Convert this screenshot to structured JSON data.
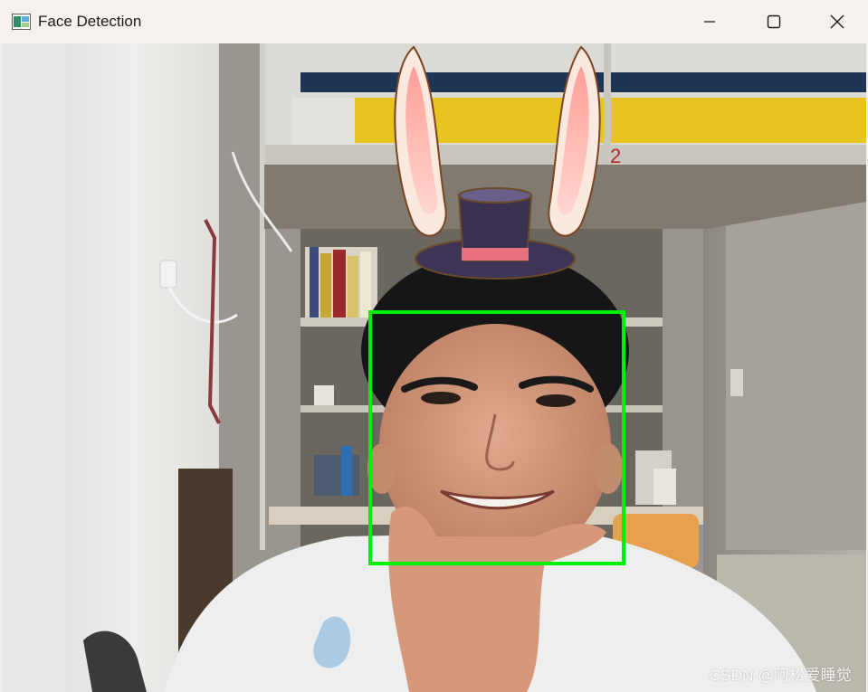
{
  "window": {
    "title": "Face Detection",
    "controls": {
      "minimize_icon": "minimize-icon",
      "maximize_icon": "maximize-icon",
      "close_icon": "close-icon"
    }
  },
  "video": {
    "overlay_sticker": "bunny-ears-top-hat",
    "detection_box_color": "#00ff00",
    "watermark": "CSDN @阿松爱睡觉"
  },
  "colors": {
    "titlebar_bg": "#f5f1ee",
    "detection_box": "#00ff00",
    "wall": "#e6e4e1",
    "bunk_yellow": "#e8c420",
    "bunk_navy": "#1f3556"
  }
}
